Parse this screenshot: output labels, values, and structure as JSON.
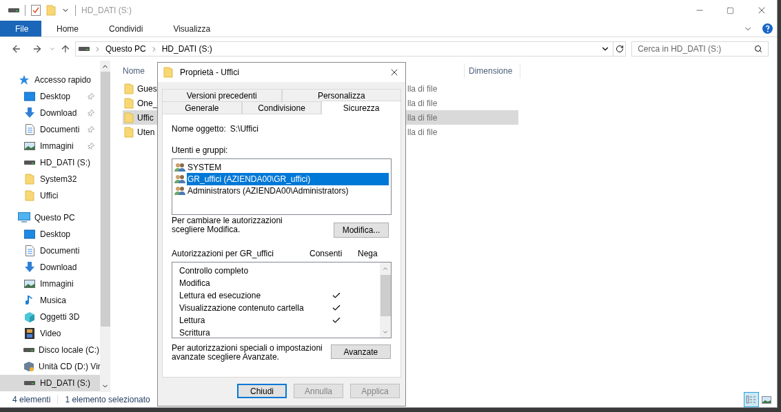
{
  "window": {
    "title": "HD_DATI (S:)"
  },
  "ribbon_tabs": [
    {
      "label": "File",
      "selected": true
    },
    {
      "label": "Home",
      "selected": false
    },
    {
      "label": "Condividi",
      "selected": false
    },
    {
      "label": "Visualizza",
      "selected": false
    }
  ],
  "address": {
    "crumbs": [
      "Questo PC",
      "HD_DATI (S:)"
    ]
  },
  "search": {
    "placeholder": "Cerca in HD_DATI (S:)"
  },
  "navigation": [
    {
      "label": "Accesso rapido",
      "kind": "star",
      "selected": false,
      "children": [
        {
          "label": "Desktop",
          "kind": "desktop",
          "pinned": true,
          "selected": false
        },
        {
          "label": "Download",
          "kind": "download",
          "pinned": true,
          "selected": false
        },
        {
          "label": "Documenti",
          "kind": "documents",
          "pinned": true,
          "selected": false
        },
        {
          "label": "Immagini",
          "kind": "pictures",
          "pinned": true,
          "selected": false
        },
        {
          "label": "HD_DATI (S:)",
          "kind": "drive",
          "pinned": false,
          "selected": false
        },
        {
          "label": "System32",
          "kind": "folder",
          "pinned": false,
          "selected": false
        },
        {
          "label": "Uffici",
          "kind": "folder",
          "pinned": false,
          "selected": false
        }
      ]
    },
    {
      "label": "Questo PC",
      "kind": "pc",
      "selected": false,
      "children": [
        {
          "label": "Desktop",
          "kind": "desktop",
          "selected": false
        },
        {
          "label": "Documenti",
          "kind": "documents",
          "selected": false
        },
        {
          "label": "Download",
          "kind": "download",
          "selected": false
        },
        {
          "label": "Immagini",
          "kind": "pictures",
          "selected": false
        },
        {
          "label": "Musica",
          "kind": "music",
          "selected": false
        },
        {
          "label": "Oggetti 3D",
          "kind": "objects3d",
          "selected": false
        },
        {
          "label": "Video",
          "kind": "video",
          "selected": false
        },
        {
          "label": "Disco locale (C:)",
          "kind": "drive",
          "selected": false
        },
        {
          "label": "Unità CD (D:) Vir",
          "kind": "cd",
          "selected": false
        },
        {
          "label": "HD_DATI (S:)",
          "kind": "drive",
          "selected": true
        }
      ]
    }
  ],
  "file_list": {
    "columns": [
      "Nome",
      "Dimensione"
    ],
    "rows": [
      {
        "name": "Gues",
        "type": "lla di file",
        "selected": false
      },
      {
        "name": "One_",
        "type": "lla di file",
        "selected": false
      },
      {
        "name": "Uffic",
        "type": "lla di file",
        "selected": true
      },
      {
        "name": "Uten",
        "type": "lla di file",
        "selected": false
      }
    ]
  },
  "status_bar": {
    "count": "4 elementi",
    "selection": "1 elemento selezionato"
  },
  "dialog": {
    "title": "Proprietà - Uffici",
    "tab_rows": [
      [
        {
          "label": "Versioni precedenti",
          "selected": false
        },
        {
          "label": "Personalizza",
          "selected": false
        }
      ],
      [
        {
          "label": "Generale",
          "selected": false
        },
        {
          "label": "Condivisione",
          "selected": false
        },
        {
          "label": "Sicurezza",
          "selected": true
        }
      ]
    ],
    "object_label": "Nome oggetto:",
    "object_value": "S:\\Uffici",
    "users_label": "Utenti e gruppi:",
    "users": [
      {
        "name": "SYSTEM",
        "selected": false
      },
      {
        "name": "GR_uffici (AZIENDA00\\GR_uffici)",
        "selected": true
      },
      {
        "name": "Administrators (AZIENDA00\\Administrators)",
        "selected": false
      }
    ],
    "edit_hint": "Per cambiare le autorizzazioni scegliere Modifica.",
    "edit_button": "Modifica...",
    "permissions_label": "Autorizzazioni per GR_uffici",
    "allow_label": "Consenti",
    "deny_label": "Nega",
    "permissions": [
      {
        "name": "Controllo completo",
        "allow": false,
        "deny": false
      },
      {
        "name": "Modifica",
        "allow": false,
        "deny": false
      },
      {
        "name": "Lettura ed esecuzione",
        "allow": true,
        "deny": false
      },
      {
        "name": "Visualizzazione contenuto cartella",
        "allow": true,
        "deny": false
      },
      {
        "name": "Lettura",
        "allow": true,
        "deny": false
      },
      {
        "name": "Scrittura",
        "allow": false,
        "deny": false
      }
    ],
    "advanced_hint": "Per autorizzazioni speciali o impostazioni avanzate scegliere Avanzate.",
    "advanced_button": "Avanzate",
    "buttons": [
      {
        "label": "Chiudi",
        "default": true,
        "disabled": false
      },
      {
        "label": "Annulla",
        "default": false,
        "disabled": true
      },
      {
        "label": "Applica",
        "default": false,
        "disabled": true
      }
    ]
  }
}
